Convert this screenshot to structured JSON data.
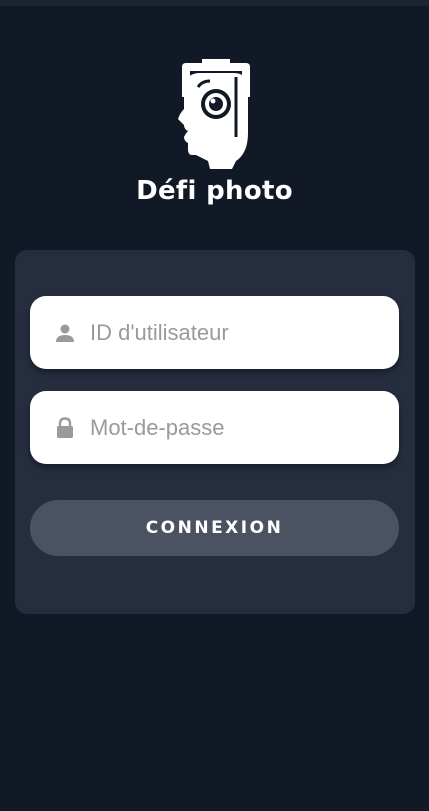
{
  "app": {
    "title": "Défi photo",
    "logo_icon": "head-camera-logo"
  },
  "login": {
    "username": {
      "placeholder": "ID d'utilisateur",
      "value": "",
      "icon": "user-icon"
    },
    "password": {
      "placeholder": "Mot-de-passe",
      "value": "",
      "icon": "lock-icon"
    },
    "submit_label": "CONNEXION"
  },
  "colors": {
    "background": "#121926",
    "card": "#252d3f",
    "button": "#4b5363",
    "input_bg": "#ffffff",
    "placeholder": "#9a9a9a",
    "text_light": "#ffffff"
  }
}
